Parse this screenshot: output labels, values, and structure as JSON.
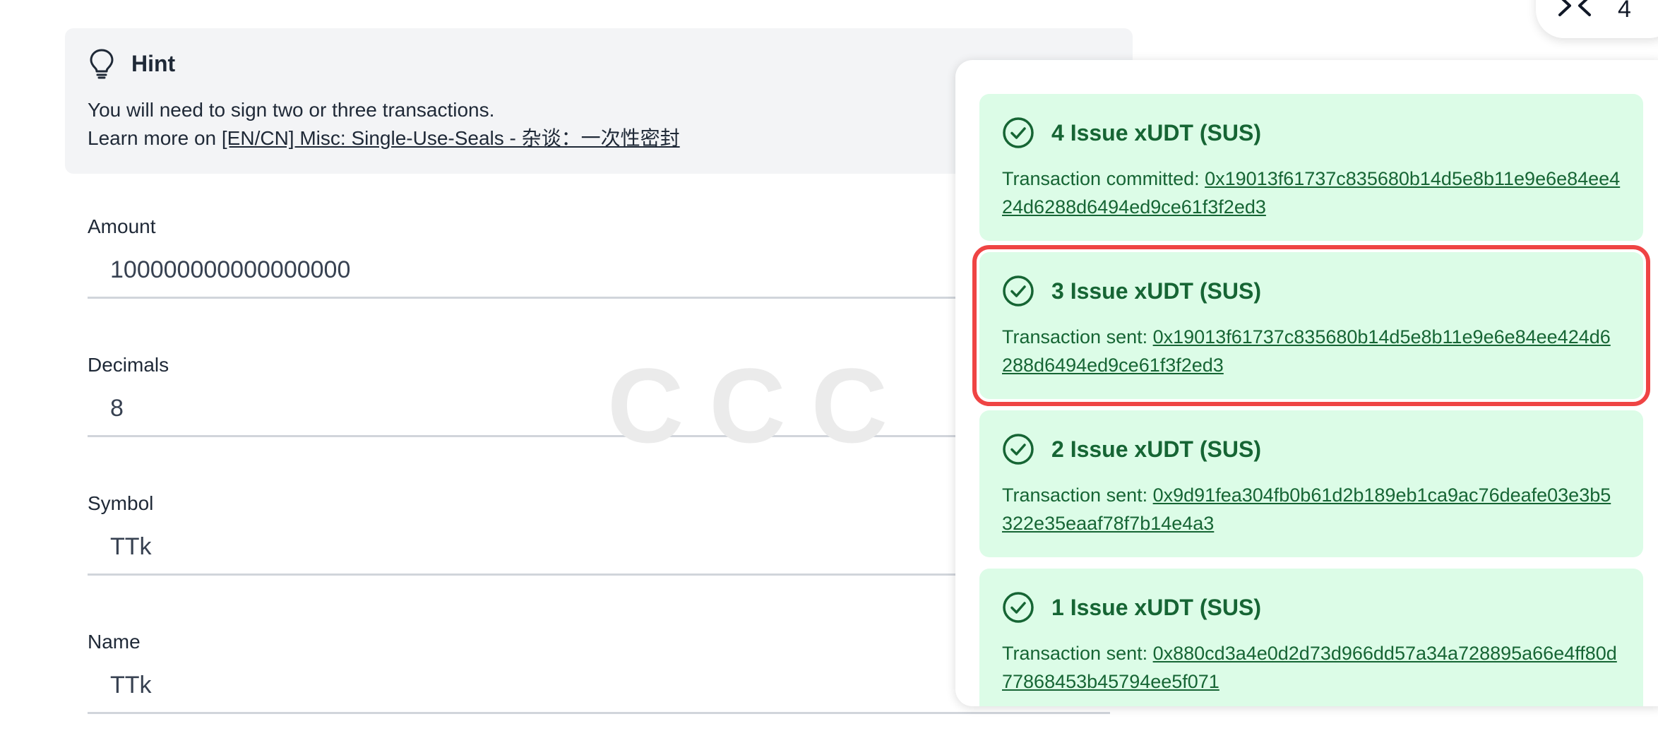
{
  "hint": {
    "icon": "lightbulb-icon",
    "title": "Hint",
    "line1": "You will need to sign two or three transactions.",
    "line2_prefix": "Learn more on ",
    "link_text": "[EN/CN] Misc: Single-Use-Seals - 杂谈：一次性密封"
  },
  "form": {
    "amount": {
      "label": "Amount",
      "value": "100000000000000000"
    },
    "decimals": {
      "label": "Decimals",
      "value": "8"
    },
    "symbol": {
      "label": "Symbol",
      "value": "TTk"
    },
    "name": {
      "label": "Name",
      "value": "TTk"
    }
  },
  "watermark": "CCC",
  "chip": {
    "icon": "collapse-chevrons-icon",
    "count": "4"
  },
  "toasts": [
    {
      "title": "4 Issue xUDT (SUS)",
      "status": "Transaction committed: ",
      "hash": "0x19013f61737c835680b14d5e8b11e9e6e84ee424d6288d6494ed9ce61f3f2ed3"
    },
    {
      "title": "3 Issue xUDT (SUS)",
      "status": "Transaction sent: ",
      "hash": "0x19013f61737c835680b14d5e8b11e9e6e84ee424d6288d6494ed9ce61f3f2ed3"
    },
    {
      "title": "2 Issue xUDT (SUS)",
      "status": "Transaction sent: ",
      "hash": "0x9d91fea304fb0b61d2b189eb1ca9ac76deafe03e3b5322e35eaaf78f7b14e4a3"
    },
    {
      "title": "1 Issue xUDT (SUS)",
      "status": "Transaction sent: ",
      "hash": "0x880cd3a4e0d2d73d966dd57a34a728895a66e4ff80d77868453b45794ee5f071"
    }
  ],
  "colors": {
    "toast_bg": "#dcfce7",
    "toast_text": "#166534",
    "highlight": "#ef4444",
    "hint_bg": "#f3f4f6"
  }
}
